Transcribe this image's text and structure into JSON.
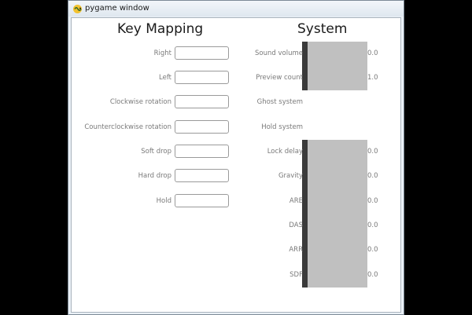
{
  "window": {
    "title": "pygame window",
    "icon": "pygame-snake-icon"
  },
  "key_mapping": {
    "heading": "Key Mapping",
    "rows": [
      {
        "label": "Right",
        "value": ""
      },
      {
        "label": "Left",
        "value": ""
      },
      {
        "label": "Clockwise rotation",
        "value": ""
      },
      {
        "label": "Counterclockwise rotation",
        "value": ""
      },
      {
        "label": "Soft drop",
        "value": ""
      },
      {
        "label": "Hard drop",
        "value": ""
      },
      {
        "label": "Hold",
        "value": ""
      }
    ]
  },
  "system": {
    "heading": "System",
    "sound_volume": {
      "label": "Sound volume",
      "value": "0.0",
      "level": 0.0
    },
    "preview_count": {
      "label": "Preview count",
      "value": "1.0",
      "level": 0.0
    },
    "ghost_system": {
      "label": "Ghost system"
    },
    "hold_system": {
      "label": "Hold system"
    },
    "lock_delay": {
      "label": "Lock delay",
      "value": "0.0",
      "level": 0.0
    },
    "gravity": {
      "label": "Gravity",
      "value": "0.0",
      "level": 0.0
    },
    "are": {
      "label": "ARE",
      "value": "0.0",
      "level": 0.0
    },
    "das": {
      "label": "DAS",
      "value": "0.0",
      "level": 0.0
    },
    "arr": {
      "label": "ARR",
      "value": "0.0",
      "level": 0.0
    },
    "sdf": {
      "label": "SDF",
      "value": "0.0",
      "level": 0.0
    }
  },
  "colors": {
    "slider_track": "#c0c0c0",
    "slider_handle": "#3a3a3a",
    "label_text": "#7a7a7a"
  }
}
